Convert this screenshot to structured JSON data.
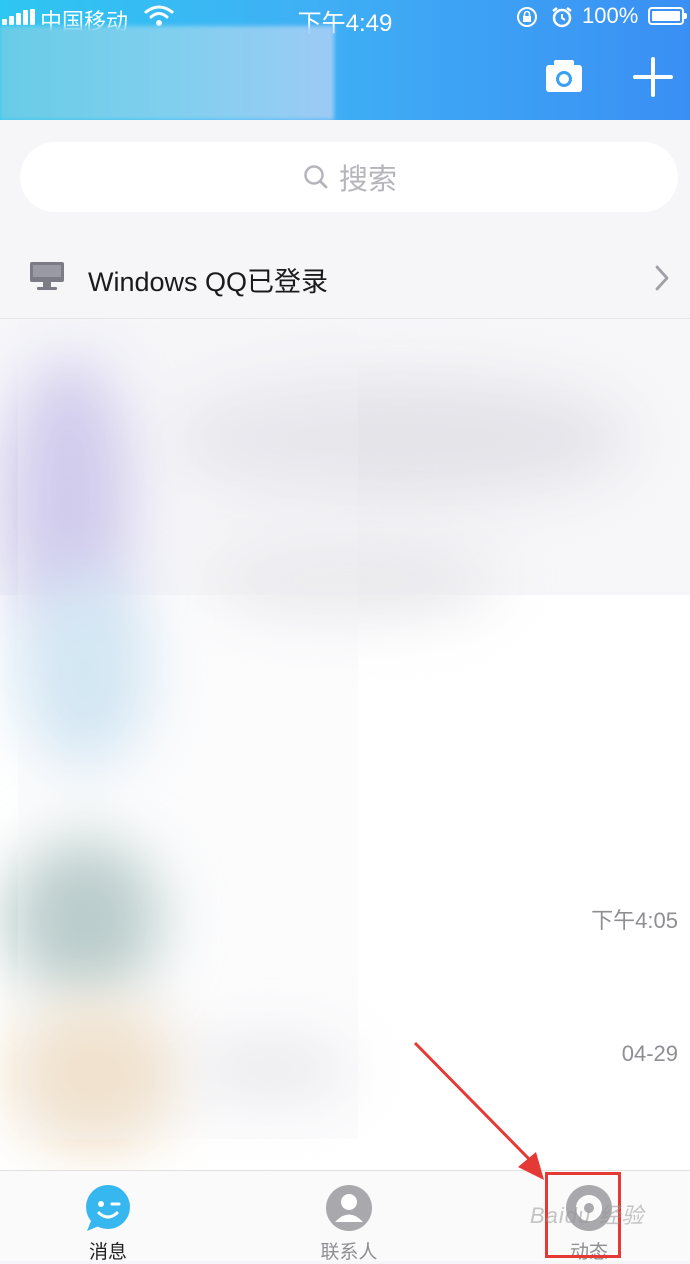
{
  "status_bar": {
    "carrier": "中国移动",
    "time": "下午4:49",
    "battery": "100%"
  },
  "search": {
    "placeholder": "搜索"
  },
  "pc_login": {
    "label": "Windows QQ已登录"
  },
  "messages": {
    "times": [
      "下午4:05",
      "04-29"
    ]
  },
  "tabbar": {
    "items": [
      {
        "label": "消息"
      },
      {
        "label": "联系人"
      },
      {
        "label": "动态"
      }
    ]
  },
  "watermark": "Baidu 经验",
  "colors": {
    "header_start": "#2ec6f2",
    "header_end": "#3a8ff4",
    "annotation": "#e53935"
  }
}
